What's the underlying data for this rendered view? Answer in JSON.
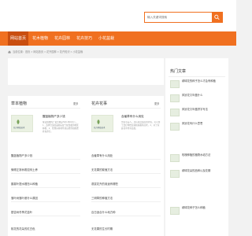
{
  "search": {
    "placeholder": "输入关键词搜索"
  },
  "nav": [
    "网站首页",
    "花木植物",
    "花卉园林",
    "花卉技巧",
    "小花盆栽"
  ],
  "breadcrumb": "当前位置：首页 » 网站首页 » 花卉园林 » 花卉知识 » 小花盆栽",
  "sections": {
    "left": {
      "title": "草本植物",
      "more": "更多",
      "featured": {
        "title": "醒蓝植物产多少钱",
        "thumb_caption": "花卉种植技术",
        "desc": "醒蓝植物的产量大概是500-800公斤，1、选择合适的品种后在气候温暖的地区种植，2、管理好基地环境后修剪和施肥补充养分。"
      },
      "items": [
        "醒蓝植物产多少钱",
        "懂得正常树着如何土养",
        "藤蔓叶提水槽怎么种植",
        "落叶树落叶都什么原因",
        "银杏树冬季花苗叶",
        "桃花的花朵的红白色"
      ]
    },
    "right": {
      "title": "花卉花事",
      "more": "更多",
      "featured": {
        "title": "含羞草有什么用处",
        "thumb_caption": "花卉种植技术",
        "desc": "含羞草美人，具有观赏和药用价值，可以用于治疗神经衰弱和失眠等症状，2、对于家庭花草也有益处。"
      },
      "items": [
        "含羞草有什么用处",
        "无花果的繁殖方法",
        "观赏花卉的用途有哪些",
        "三明草的种植方法",
        "百日适合什么地方种",
        "无花果的生长时期"
      ]
    }
  },
  "sidebar": {
    "title": "热门文章",
    "items": [
      "绣球花的种子怎么才会有种植",
      "风铃花又叫做什么",
      "风铃花又叫做拼字写法",
      "风铃花叫什么意思",
      "玫瑰种植的植物水培方法",
      "绣球花朵的品种以及花期",
      "绣球花种子怎么种植"
    ]
  }
}
